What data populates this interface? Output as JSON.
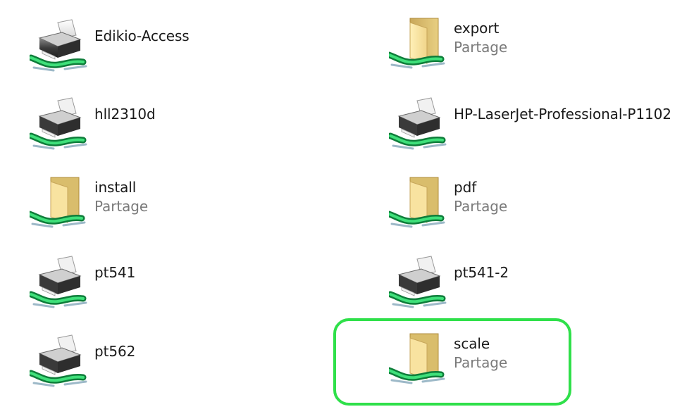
{
  "items": [
    {
      "name": "Edikio-Access",
      "type": "printer",
      "subtitle": ""
    },
    {
      "name": "export",
      "type": "folder",
      "subtitle": "Partage"
    },
    {
      "name": "hll2310d",
      "type": "printer",
      "subtitle": ""
    },
    {
      "name": "HP-LaserJet-Professional-P1102",
      "type": "printer",
      "subtitle": ""
    },
    {
      "name": "install",
      "type": "folder",
      "subtitle": "Partage"
    },
    {
      "name": "pdf",
      "type": "folder",
      "subtitle": "Partage"
    },
    {
      "name": "pt541",
      "type": "printer",
      "subtitle": ""
    },
    {
      "name": "pt541-2",
      "type": "printer",
      "subtitle": ""
    },
    {
      "name": "pt562",
      "type": "printer",
      "subtitle": ""
    },
    {
      "name": "scale",
      "type": "folder",
      "subtitle": "Partage"
    }
  ],
  "icons": {
    "printer": "network-printer-icon",
    "folder": "shared-folder-icon",
    "network_cable": "network-cable-icon"
  },
  "colors": {
    "highlight": "#2fe04a",
    "name_text": "#1a1a1a",
    "subtitle_text": "#7a7a7a",
    "background": "#ffffff"
  },
  "highlighted_item": "scale"
}
